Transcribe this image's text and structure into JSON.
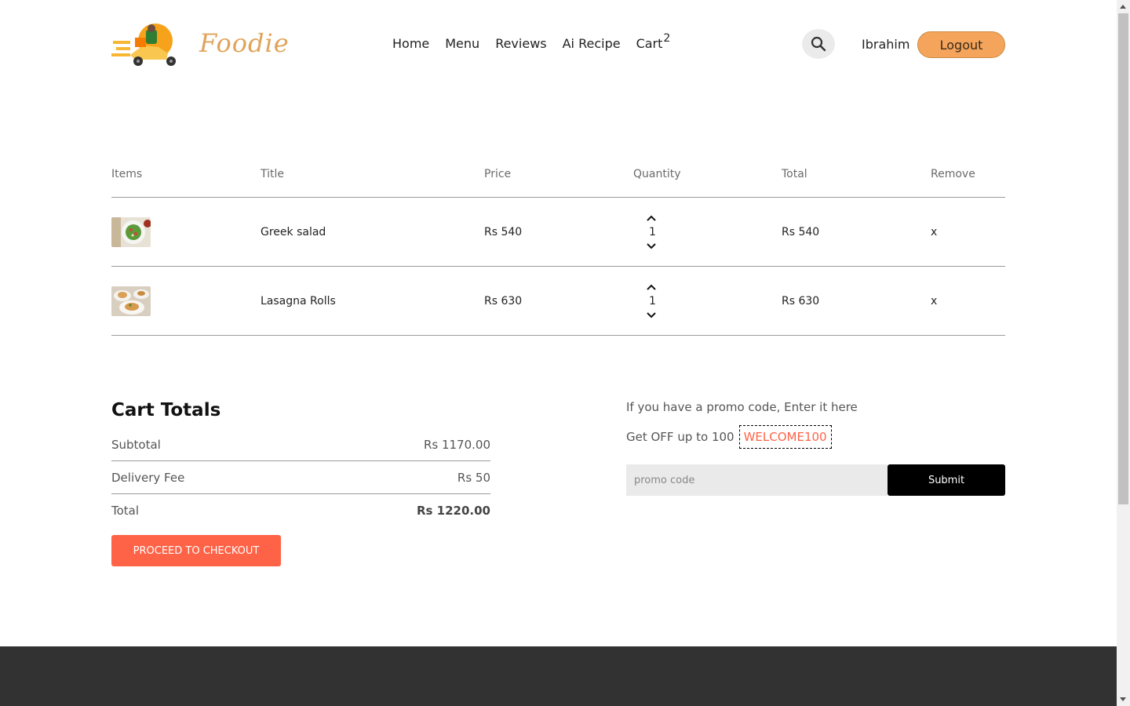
{
  "header": {
    "brand": "Foodie",
    "nav": [
      "Home",
      "Menu",
      "Reviews",
      "Ai Recipe"
    ],
    "cart_label": "Cart",
    "cart_count": "2",
    "username": "Ibrahim",
    "logout_label": "Logout"
  },
  "table": {
    "headers": [
      "Items",
      "Title",
      "Price",
      "Quantity",
      "Total",
      "Remove"
    ],
    "rows": [
      {
        "title": "Greek salad",
        "price": "Rs 540",
        "quantity": "1",
        "total": "Rs 540",
        "remove": "x"
      },
      {
        "title": "Lasagna Rolls",
        "price": "Rs 630",
        "quantity": "1",
        "total": "Rs 630",
        "remove": "x"
      }
    ]
  },
  "totals": {
    "title": "Cart Totals",
    "subtotal_label": "Subtotal",
    "subtotal_value": "Rs 1170.00",
    "delivery_label": "Delivery Fee",
    "delivery_value": "Rs 50",
    "total_label": "Total",
    "total_value": "Rs 1220.00",
    "checkout_label": "PROCEED TO CHECKOUT"
  },
  "promo": {
    "line1": "If you have a promo code, Enter it here",
    "line2": "Get OFF up to 100",
    "code": "WELCOME100",
    "input_placeholder": "promo code",
    "input_value": "",
    "submit_label": "Submit"
  },
  "colors": {
    "accent": "#ff6347",
    "logout": "#f4a45b",
    "brand": "#e0a35a",
    "footer": "#323232"
  }
}
